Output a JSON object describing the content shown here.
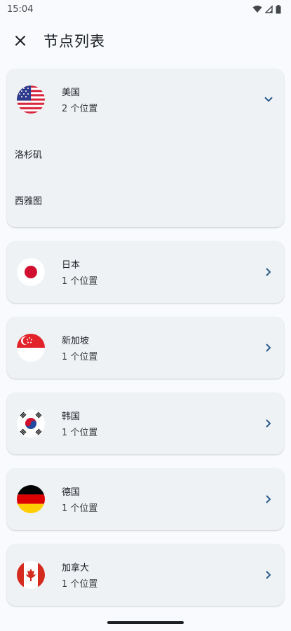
{
  "status_bar": {
    "time": "15:04"
  },
  "header": {
    "title": "节点列表",
    "close_icon": "close-icon"
  },
  "colors": {
    "chevron": "#2a5c8a",
    "card_bg": "#eef2f5",
    "page_bg": "#f8fafd"
  },
  "countries": [
    {
      "name": "美国",
      "count": "2 个位置",
      "expanded": true,
      "locations": [
        "洛杉矶",
        "西雅图"
      ]
    },
    {
      "name": "日本",
      "count": "1 个位置",
      "expanded": false
    },
    {
      "name": "新加坡",
      "count": "1 个位置",
      "expanded": false
    },
    {
      "name": "韩国",
      "count": "1 个位置",
      "expanded": false
    },
    {
      "name": "德国",
      "count": "1 个位置",
      "expanded": false
    },
    {
      "name": "加拿大",
      "count": "1 个位置",
      "expanded": false
    }
  ]
}
